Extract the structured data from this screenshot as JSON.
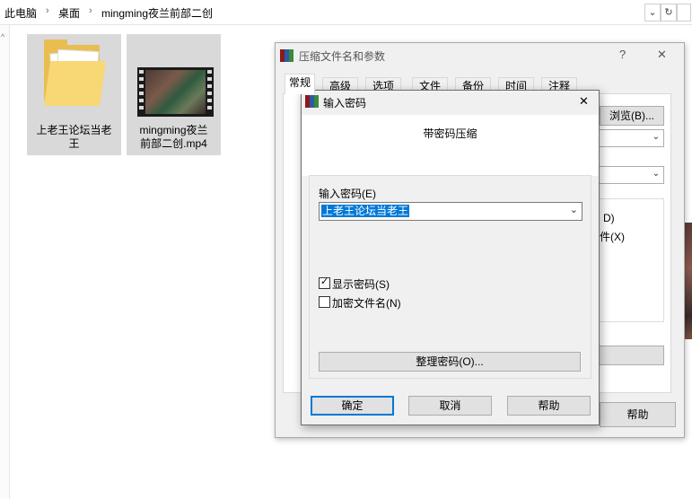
{
  "explorer": {
    "breadcrumbs": [
      "此电脑",
      "桌面",
      "mingming夜兰前部二创"
    ],
    "refresh_icon": "refresh-icon",
    "files": [
      {
        "name": "上老王论坛当老\n王",
        "icon": "folder-icon"
      },
      {
        "name": "mingming夜兰\n前部二创.mp4",
        "icon": "video-thumbnail"
      }
    ]
  },
  "compress_dialog": {
    "title": "压缩文件名和参数",
    "help": "?",
    "close": "✕",
    "tabs": [
      "常规",
      "高级",
      "选项",
      "文件",
      "备份",
      "时间",
      "注释"
    ],
    "browse_label": "浏览(B)...",
    "option_d_fragment": "D)",
    "option_x_fragment": "件(X)",
    "help_button": "帮助"
  },
  "password_dialog": {
    "title": "输入密码",
    "close": "✕",
    "heading": "带密码压缩",
    "password_label": "输入密码(E)",
    "password_value": "上老王论坛当老王",
    "show_password_label": "显示密码(S)",
    "show_password_checked": true,
    "encrypt_names_label": "加密文件名(N)",
    "encrypt_names_checked": false,
    "organize_button": "整理密码(O)...",
    "ok": "确定",
    "cancel": "取消",
    "help": "帮助"
  }
}
